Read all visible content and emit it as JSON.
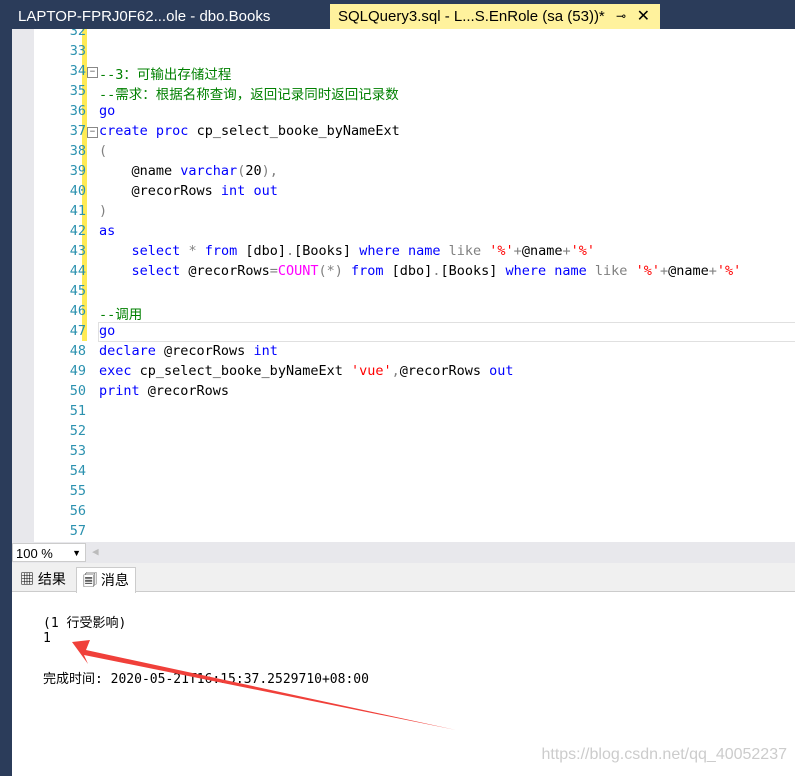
{
  "tabs": [
    {
      "label": "LAPTOP-FPRJ0F62...ole - dbo.Books"
    },
    {
      "label": "SQLQuery3.sql - L...S.EnRole (sa (53))*",
      "pin": "⊸",
      "close": "✕"
    }
  ],
  "editor": {
    "lines": [
      {
        "n": "32",
        "t": []
      },
      {
        "n": "33",
        "t": []
      },
      {
        "n": "34",
        "fold": true,
        "t": [
          [
            "--3：可输出存储过程",
            "cm"
          ]
        ]
      },
      {
        "n": "35",
        "t": [
          [
            "--需求：根据名称查询，返回记录同时返回记录数",
            "cm"
          ]
        ]
      },
      {
        "n": "36",
        "t": [
          [
            "go",
            "kw"
          ]
        ]
      },
      {
        "n": "37",
        "fold": true,
        "t": [
          [
            "create",
            "kw"
          ],
          [
            " "
          ],
          [
            "proc",
            "kw"
          ],
          [
            " cp_select_booke_byNameExt"
          ]
        ]
      },
      {
        "n": "38",
        "t": [
          [
            "(",
            "op"
          ]
        ]
      },
      {
        "n": "39",
        "t": [
          [
            "    @name "
          ],
          [
            "varchar",
            "kw"
          ],
          [
            "(",
            "op"
          ],
          [
            "20"
          ],
          [
            ")",
            "op"
          ],
          [
            ",",
            "op"
          ]
        ]
      },
      {
        "n": "40",
        "t": [
          [
            "    @recorRows "
          ],
          [
            "int",
            "kw"
          ],
          [
            " "
          ],
          [
            "out",
            "kw"
          ]
        ]
      },
      {
        "n": "41",
        "t": [
          [
            ")",
            "op"
          ]
        ]
      },
      {
        "n": "42",
        "t": [
          [
            "as",
            "kw"
          ]
        ]
      },
      {
        "n": "43",
        "t": [
          [
            "    "
          ],
          [
            "select",
            "kw"
          ],
          [
            " "
          ],
          [
            "*",
            "op"
          ],
          [
            " "
          ],
          [
            "from",
            "kw"
          ],
          [
            " [dbo]"
          ],
          [
            ".",
            "op"
          ],
          [
            "[Books] "
          ],
          [
            "where",
            "kw"
          ],
          [
            " "
          ],
          [
            "name",
            "kw"
          ],
          [
            " "
          ],
          [
            "like",
            "op"
          ],
          [
            " "
          ],
          [
            "'%'",
            "st"
          ],
          [
            "+",
            "op"
          ],
          [
            "@name"
          ],
          [
            "+",
            "op"
          ],
          [
            "'%'",
            "st"
          ]
        ]
      },
      {
        "n": "44",
        "t": [
          [
            "    "
          ],
          [
            "select",
            "kw"
          ],
          [
            " @recorRows"
          ],
          [
            "=",
            "op"
          ],
          [
            "COUNT",
            "fn"
          ],
          [
            "(*)",
            "op"
          ],
          [
            " "
          ],
          [
            "from",
            "kw"
          ],
          [
            " [dbo]"
          ],
          [
            ".",
            "op"
          ],
          [
            "[Books] "
          ],
          [
            "where",
            "kw"
          ],
          [
            " "
          ],
          [
            "name",
            "kw"
          ],
          [
            " "
          ],
          [
            "like",
            "op"
          ],
          [
            " "
          ],
          [
            "'%'",
            "st"
          ],
          [
            "+",
            "op"
          ],
          [
            "@name"
          ],
          [
            "+",
            "op"
          ],
          [
            "'%'",
            "st"
          ]
        ]
      },
      {
        "n": "45",
        "t": []
      },
      {
        "n": "46",
        "t": [
          [
            "--调用",
            "cm"
          ]
        ]
      },
      {
        "n": "47",
        "t": [
          [
            "go",
            "kw"
          ]
        ]
      },
      {
        "n": "48",
        "t": [
          [
            "declare",
            "kw"
          ],
          [
            " @recorRows "
          ],
          [
            "int",
            "kw"
          ]
        ]
      },
      {
        "n": "49",
        "t": [
          [
            "exec",
            "kw"
          ],
          [
            " cp_select_booke_byNameExt "
          ],
          [
            "'vue'",
            "st"
          ],
          [
            ",",
            "op"
          ],
          [
            "@recorRows "
          ],
          [
            "out",
            "kw"
          ]
        ]
      },
      {
        "n": "50",
        "t": [
          [
            "print",
            "kw"
          ],
          [
            " @recorRows"
          ]
        ]
      },
      {
        "n": "51",
        "t": []
      },
      {
        "n": "52",
        "t": []
      },
      {
        "n": "53",
        "t": []
      },
      {
        "n": "54",
        "t": []
      },
      {
        "n": "55",
        "t": []
      },
      {
        "n": "56",
        "t": []
      },
      {
        "n": "57",
        "t": []
      }
    ]
  },
  "zoom": {
    "value": "100 %"
  },
  "results_tabs": [
    {
      "label": "结果",
      "icon": "grid-icon"
    },
    {
      "label": "消息",
      "icon": "messages-icon",
      "active": true
    }
  ],
  "messages": {
    "affected": "(1 行受影响)",
    "printed": "1",
    "completion": "完成时间: 2020-05-21T16:15:37.2529710+08:00"
  },
  "watermark": "https://blog.csdn.net/qq_40052237",
  "colors": {
    "keyword": "#0000ff",
    "comment": "#008000",
    "string": "#ff0000",
    "arrow": "#f0403a"
  }
}
